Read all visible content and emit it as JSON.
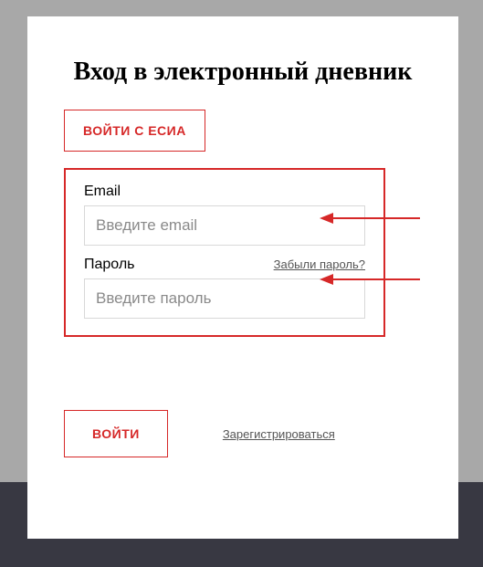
{
  "title": "Вход в электронный дневник",
  "esia_button": "ВОЙТИ С ЕСИА",
  "form": {
    "email_label": "Email",
    "email_placeholder": "Введите email",
    "password_label": "Пароль",
    "password_placeholder": "Введите пароль",
    "forgot_password": "Забыли пароль?"
  },
  "login_button": "ВОЙТИ",
  "register_link": "Зарегистрироваться"
}
